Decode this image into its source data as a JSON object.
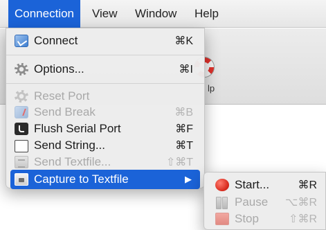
{
  "menubar": {
    "items": [
      {
        "label": "Connection",
        "active": true
      },
      {
        "label": "View",
        "active": false
      },
      {
        "label": "Window",
        "active": false
      },
      {
        "label": "Help",
        "active": false
      }
    ]
  },
  "background_app": {
    "help_label": "lp"
  },
  "connection_menu": {
    "items": [
      {
        "label": "Connect",
        "shortcut": "⌘K",
        "icon": "connect-icon",
        "enabled": true
      },
      {
        "label": "Options...",
        "shortcut": "⌘I",
        "icon": "gear-icon",
        "enabled": true
      },
      {
        "label": "Reset Port",
        "shortcut": "",
        "icon": "reset-port-icon",
        "enabled": false
      },
      {
        "label": "Send Break",
        "shortcut": "⌘B",
        "icon": "send-break-icon",
        "enabled": false
      },
      {
        "label": "Flush Serial Port",
        "shortcut": "⌘F",
        "icon": "flush-icon",
        "enabled": true
      },
      {
        "label": "Send String...",
        "shortcut": "⌘T",
        "icon": "string-field-icon",
        "enabled": true
      },
      {
        "label": "Send Textfile...",
        "shortcut": "⇧⌘T",
        "icon": "textfile-icon",
        "enabled": false
      },
      {
        "label": "Capture to Textfile",
        "shortcut": "",
        "icon": "capture-icon",
        "enabled": true,
        "highlighted": true,
        "submenu_arrow": "▶"
      }
    ]
  },
  "capture_submenu": {
    "items": [
      {
        "label": "Start...",
        "shortcut": "⌘R",
        "icon": "record-icon",
        "enabled": true
      },
      {
        "label": "Pause",
        "shortcut": "⌥⌘R",
        "icon": "pause-icon",
        "enabled": false
      },
      {
        "label": "Stop",
        "shortcut": "⇧⌘R",
        "icon": "stop-icon",
        "enabled": false
      }
    ]
  },
  "colors": {
    "selection": "#1b63d8",
    "menu_background": "#ececec",
    "disabled_text": "#a9a9a9",
    "record_red": "#d92c1f"
  }
}
